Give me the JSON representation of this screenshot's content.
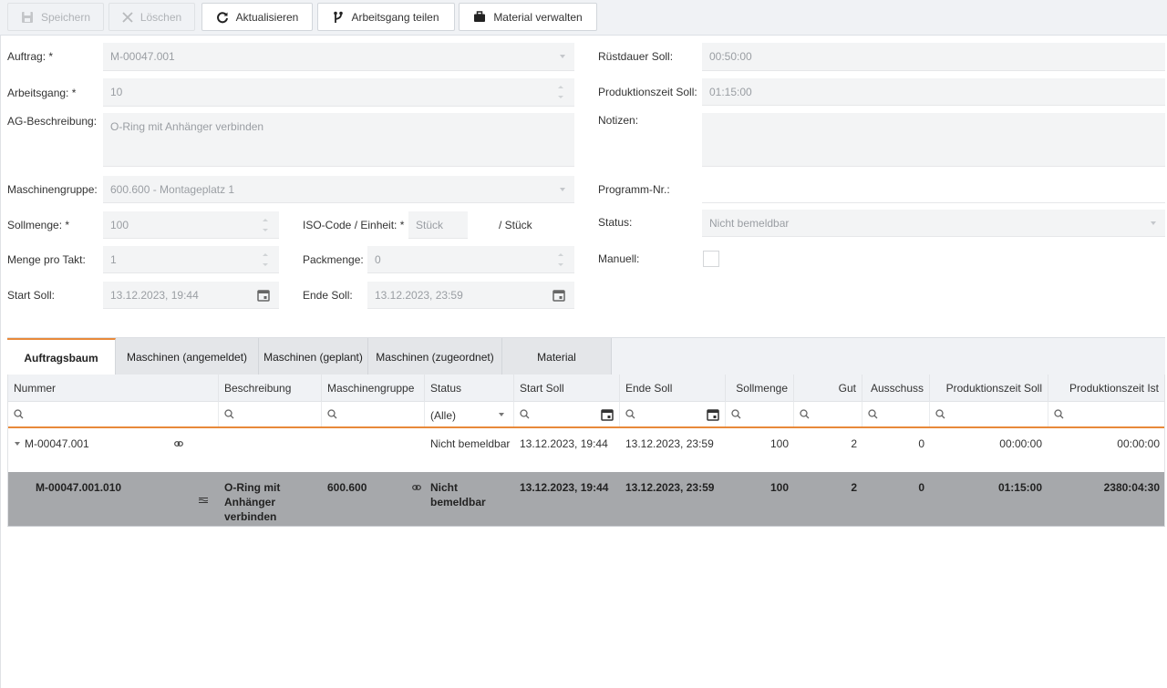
{
  "toolbar": {
    "save": "Speichern",
    "delete": "Löschen",
    "refresh": "Aktualisieren",
    "split": "Arbeitsgang teilen",
    "material": "Material verwalten"
  },
  "form": {
    "auftrag_label": "Auftrag: *",
    "auftrag_value": "M-00047.001",
    "arbeitsgang_label": "Arbeitsgang: *",
    "arbeitsgang_value": "10",
    "ag_beschreibung_label": "AG-Beschreibung:",
    "ag_beschreibung_value": "O-Ring mit Anhänger verbinden",
    "maschinengruppe_label": "Maschinengruppe:",
    "maschinengruppe_value": "600.600 - Montageplatz 1",
    "sollmenge_label": "Sollmenge: *",
    "sollmenge_value": "100",
    "iso_label": "ISO-Code / Einheit: *",
    "iso_value": "Stück",
    "iso_unit": "/ Stück",
    "menge_takt_label": "Menge pro Takt:",
    "menge_takt_value": "1",
    "packmenge_label": "Packmenge:",
    "packmenge_value": "0",
    "start_soll_label": "Start Soll:",
    "start_soll_value": "13.12.2023, 19:44",
    "ende_soll_label": "Ende Soll:",
    "ende_soll_value": "13.12.2023, 23:59",
    "ruestdauer_label": "Rüstdauer Soll:",
    "ruestdauer_value": "00:50:00",
    "produktionszeit_label": "Produktionszeit Soll:",
    "produktionszeit_value": "01:15:00",
    "notizen_label": "Notizen:",
    "notizen_value": "",
    "programm_label": "Programm-Nr.:",
    "programm_value": "",
    "status_label": "Status:",
    "status_value": "Nicht bemeldbar",
    "manuell_label": "Manuell:",
    "manuell_checked": false
  },
  "tabs": [
    {
      "label": "Auftragsbaum",
      "active": true
    },
    {
      "label": "Maschinen (angemeldet)",
      "active": false
    },
    {
      "label": "Maschinen (geplant)",
      "active": false
    },
    {
      "label": "Maschinen (zugeordnet)",
      "active": false
    },
    {
      "label": "Material",
      "active": false
    }
  ],
  "grid": {
    "columns": [
      "Nummer",
      "Beschreibung",
      "Maschinengruppe",
      "Status",
      "Start Soll",
      "Ende Soll",
      "Sollmenge",
      "Gut",
      "Ausschuss",
      "Produktionszeit Soll",
      "Produktionszeit Ist"
    ],
    "status_filter": "(Alle)",
    "rows": [
      {
        "nummer": "M-00047.001",
        "beschreibung": "",
        "maschinengruppe": "",
        "status": "Nicht bemeldbar",
        "start_soll": "13.12.2023, 19:44",
        "ende_soll": "13.12.2023, 23:59",
        "sollmenge": "100",
        "gut": "2",
        "ausschuss": "0",
        "pz_soll": "00:00:00",
        "pz_ist": "00:00:00"
      },
      {
        "nummer": "M-00047.001.010",
        "beschreibung": "O-Ring mit Anhänger verbinden",
        "maschinengruppe": "600.600",
        "status": "Nicht bemeldbar",
        "start_soll": "13.12.2023, 19:44",
        "ende_soll": "13.12.2023, 23:59",
        "sollmenge": "100",
        "gut": "2",
        "ausschuss": "0",
        "pz_soll": "01:15:00",
        "pz_ist": "2380:04:30"
      }
    ]
  }
}
